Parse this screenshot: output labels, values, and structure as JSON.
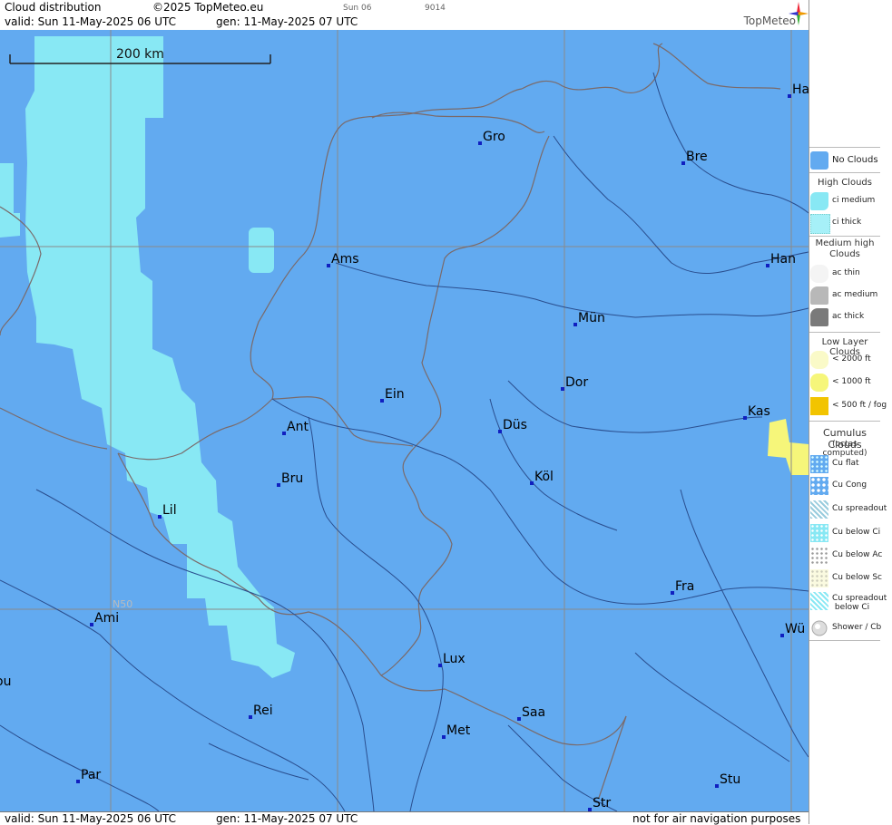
{
  "header": {
    "title": "Cloud distribution",
    "copyright": "©2025 TopMeteo.eu",
    "day_code": "Sun 06",
    "code": "9014",
    "valid": "valid:  Sun  11-May-2025  06 UTC",
    "gen": "gen: 11-May-2025 07 UTC",
    "logo": "TopMeteo"
  },
  "map": {
    "scale_label": "200 km",
    "lat_label": "N50",
    "cities": [
      {
        "name": "Gro"
      },
      {
        "name": "Bre"
      },
      {
        "name": "Ha"
      },
      {
        "name": "Ams"
      },
      {
        "name": "Han"
      },
      {
        "name": "Mün"
      },
      {
        "name": "Ein"
      },
      {
        "name": "Dor"
      },
      {
        "name": "Ant"
      },
      {
        "name": "Düs"
      },
      {
        "name": "Kas"
      },
      {
        "name": "Bru"
      },
      {
        "name": "Köl"
      },
      {
        "name": "Lil"
      },
      {
        "name": "Fra"
      },
      {
        "name": "Ami"
      },
      {
        "name": "Wü"
      },
      {
        "name": "Lux"
      },
      {
        "name": "ou"
      },
      {
        "name": "Rei"
      },
      {
        "name": "Saa"
      },
      {
        "name": "Met"
      },
      {
        "name": "Par"
      },
      {
        "name": "Stu"
      },
      {
        "name": "Str"
      }
    ],
    "colors": {
      "no_clouds": "#62aaf0",
      "ci_medium": "#88e8f4",
      "low_1000": "#f6f67a",
      "border": "#7a6a6a",
      "river": "#2a4e8e",
      "grid": "#8a8a8a"
    }
  },
  "footer": {
    "valid": "valid:  Sun  11-May-2025  06 UTC",
    "gen": "gen: 11-May-2025 07 UTC",
    "disclaimer": "not for air navigation purposes"
  },
  "legend": {
    "no_clouds": "No Clouds",
    "high_title": "High Clouds",
    "ci_medium": "ci medium",
    "ci_thick": "ci thick",
    "medium_title": "Medium high Clouds",
    "ac_thin": "ac thin",
    "ac_medium": "ac medium",
    "ac_thick": "ac thick",
    "low_title": "Low Layer Clouds",
    "low_2000": "< 2000 ft",
    "low_1000": "< 1000 ft",
    "low_500": "< 500 ft / fog",
    "cumulus_title": "Cumulus Clouds",
    "cumulus_sub": "(octas computed)",
    "cu_flat": "Cu flat",
    "cu_cong": "Cu Cong",
    "cu_spread": "Cu spreadout",
    "cu_below_ci": "Cu below Ci",
    "cu_below_ac": "Cu below Ac",
    "cu_below_sc": "Cu below Sc",
    "cu_spread_ci_1": "Cu spreadout",
    "cu_spread_ci_2": "below Ci",
    "shower": "Shower / Cb"
  }
}
